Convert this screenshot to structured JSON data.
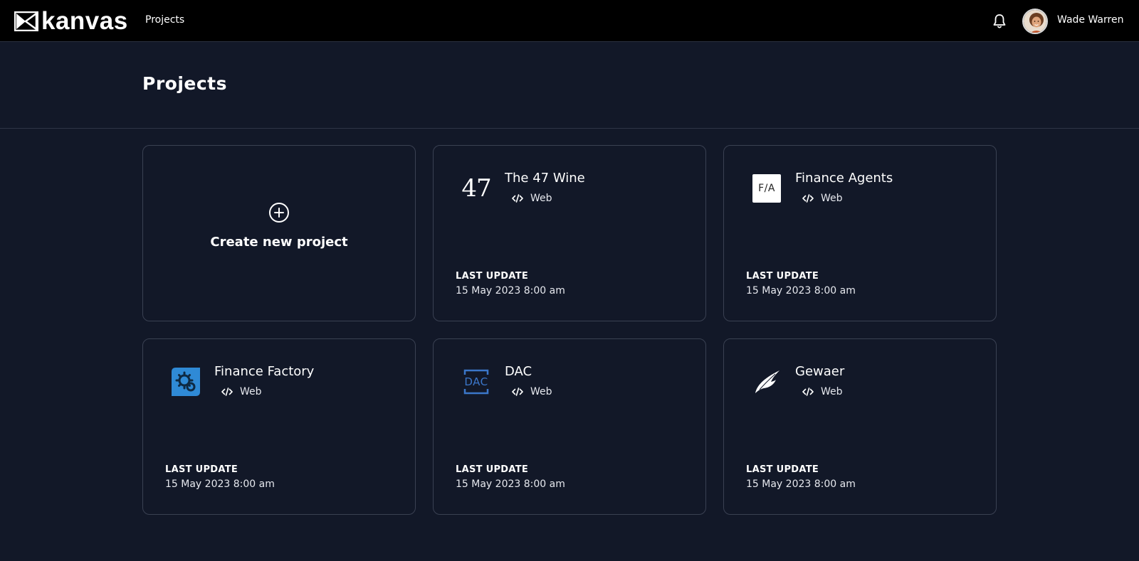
{
  "app": {
    "brand": "kanvas",
    "nav_projects": "Projects",
    "user_name": "Wade Warren"
  },
  "page": {
    "title": "Projects"
  },
  "create_card": {
    "label": "Create new project"
  },
  "projects": [
    {
      "name": "The 47 Wine",
      "type": "Web",
      "last_update_label": "LAST UPDATE",
      "last_update": "15 May 2023 8:00 am",
      "logo": "47-wine-logo",
      "logo_text": "47"
    },
    {
      "name": "Finance Agents",
      "type": "Web",
      "last_update_label": "LAST UPDATE",
      "last_update": "15 May 2023 8:00 am",
      "logo": "finance-agents-logo",
      "logo_text": "F/A"
    },
    {
      "name": "Finance Factory",
      "type": "Web",
      "last_update_label": "LAST UPDATE",
      "last_update": "15 May 2023 8:00 am",
      "logo": "finance-factory-logo"
    },
    {
      "name": "DAC",
      "type": "Web",
      "last_update_label": "LAST UPDATE",
      "last_update": "15 May 2023 8:00 am",
      "logo": "dac-logo",
      "logo_text": "DAC"
    },
    {
      "name": "Gewaer",
      "type": "Web",
      "last_update_label": "LAST UPDATE",
      "last_update": "15 May 2023 8:00 am",
      "logo": "gewaer-logo"
    }
  ],
  "icons": {
    "bell": "bell-icon",
    "plus": "plus-circle-icon",
    "code": "code-icon"
  },
  "colors": {
    "topbar_bg": "#000000",
    "page_bg": "#121828",
    "card_border": "#3a4152",
    "finance_factory_blue": "#2f8ad6",
    "dac_blue": "#3b76c9"
  }
}
